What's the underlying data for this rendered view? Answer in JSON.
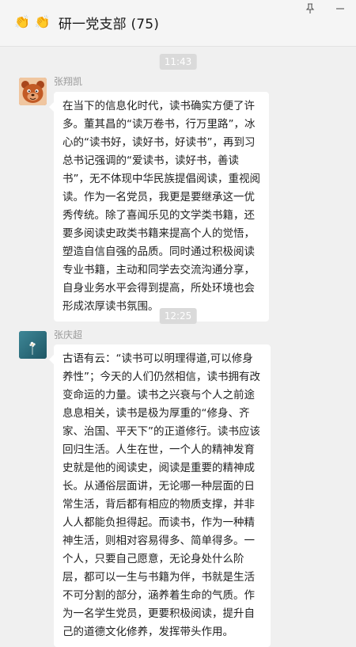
{
  "header": {
    "clap_icon_glyph": "👏",
    "title": "研一党支部 (75)",
    "controls": [
      "pin-icon",
      "minimize-icon"
    ]
  },
  "messages": [
    {
      "time": "11:43",
      "sender": "张翔凯",
      "avatar": "cartoon-bear-avatar",
      "text": "在当下的信息化时代，读书确实方便了许多。董其昌的“读万卷书，行万里路”，冰心的“读书好，读好书，好读书”，再到习总书记强调的“爱读书，读好书，善读书”，无不体现中华民族提倡阅读，重视阅读。作为一名党员，我更是要继承这一优秀传统。除了喜闻乐见的文学类书籍，还要多阅读史政类书籍来提高个人的觉悟，塑造自信自强的品质。同时通过积极阅读专业书籍，主动和同学去交流沟通分享，自身业务水平会得到提高，所处环境也会形成浓厚读书氛围。"
    },
    {
      "time": "12:25",
      "sender": "张庆超",
      "avatar": "flower-avatar",
      "text": "古语有云：“读书可以明理得道,可以修身养性”；今天的人们仍然相信，读书拥有改变命运的力量。读书之兴衰与个人之前途息息相关，读书是极为厚重的“修身、齐家、治国、平天下”的正道修行。读书应该回归生活。人生在世，一个人的精神发育史就是他的阅读史，阅读是重要的精神成长。从通俗层面讲，无论哪一种层面的日常生活，背后都有相应的物质支撑，并非人人都能负担得起。而读书，作为一种精神生活，则相对容易得多、简单得多。一个人，只要自己愿意，无论身处什么阶层，都可以一生与书籍为伴，书就是生活不可分割的部分，涵养着生命的气质。作为一名学生党员，更要积极阅读，提升自己的道德文化修养，发挥带头作用。"
    }
  ]
}
